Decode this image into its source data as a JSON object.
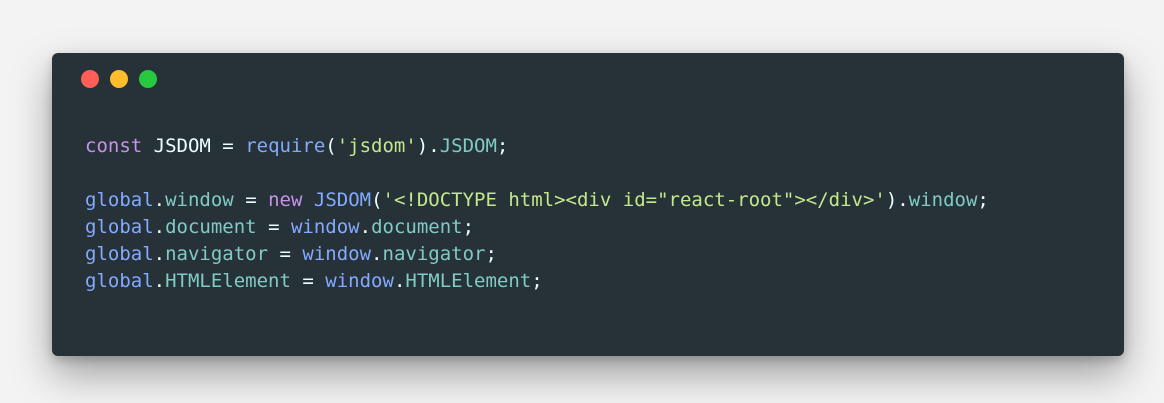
{
  "window": {
    "traffic_lights": [
      {
        "name": "close",
        "color": "#ff5f56"
      },
      {
        "name": "minimize",
        "color": "#ffbd2e"
      },
      {
        "name": "maximize",
        "color": "#27c93f"
      }
    ],
    "background": "#263238"
  },
  "code": {
    "lines": [
      [
        {
          "text": "const",
          "type": "keyword"
        },
        {
          "text": " JSDOM ",
          "type": "plain"
        },
        {
          "text": "=",
          "type": "op"
        },
        {
          "text": " ",
          "type": "plain"
        },
        {
          "text": "require",
          "type": "func"
        },
        {
          "text": "(",
          "type": "punct"
        },
        {
          "text": "'jsdom'",
          "type": "string"
        },
        {
          "text": ").",
          "type": "punct"
        },
        {
          "text": "JSDOM",
          "type": "prop"
        },
        {
          "text": ";",
          "type": "punct"
        }
      ],
      [],
      [
        {
          "text": "global",
          "type": "global"
        },
        {
          "text": ".",
          "type": "punct"
        },
        {
          "text": "window",
          "type": "prop"
        },
        {
          "text": " ",
          "type": "plain"
        },
        {
          "text": "=",
          "type": "op"
        },
        {
          "text": " ",
          "type": "plain"
        },
        {
          "text": "new",
          "type": "keyword"
        },
        {
          "text": " ",
          "type": "plain"
        },
        {
          "text": "JSDOM",
          "type": "func"
        },
        {
          "text": "(",
          "type": "punct"
        },
        {
          "text": "'<!DOCTYPE html><div id=\"react-root\"></div>'",
          "type": "string"
        },
        {
          "text": ").",
          "type": "punct"
        },
        {
          "text": "window",
          "type": "prop"
        },
        {
          "text": ";",
          "type": "punct"
        }
      ],
      [
        {
          "text": "global",
          "type": "global"
        },
        {
          "text": ".",
          "type": "punct"
        },
        {
          "text": "document",
          "type": "prop"
        },
        {
          "text": " ",
          "type": "plain"
        },
        {
          "text": "=",
          "type": "op"
        },
        {
          "text": " ",
          "type": "plain"
        },
        {
          "text": "window",
          "type": "global"
        },
        {
          "text": ".",
          "type": "punct"
        },
        {
          "text": "document",
          "type": "prop"
        },
        {
          "text": ";",
          "type": "punct"
        }
      ],
      [
        {
          "text": "global",
          "type": "global"
        },
        {
          "text": ".",
          "type": "punct"
        },
        {
          "text": "navigator",
          "type": "prop"
        },
        {
          "text": " ",
          "type": "plain"
        },
        {
          "text": "=",
          "type": "op"
        },
        {
          "text": " ",
          "type": "plain"
        },
        {
          "text": "window",
          "type": "global"
        },
        {
          "text": ".",
          "type": "punct"
        },
        {
          "text": "navigator",
          "type": "prop"
        },
        {
          "text": ";",
          "type": "punct"
        }
      ],
      [
        {
          "text": "global",
          "type": "global"
        },
        {
          "text": ".",
          "type": "punct"
        },
        {
          "text": "HTMLElement",
          "type": "prop"
        },
        {
          "text": " ",
          "type": "plain"
        },
        {
          "text": "=",
          "type": "op"
        },
        {
          "text": " ",
          "type": "plain"
        },
        {
          "text": "window",
          "type": "global"
        },
        {
          "text": ".",
          "type": "punct"
        },
        {
          "text": "HTMLElement",
          "type": "prop"
        },
        {
          "text": ";",
          "type": "punct"
        }
      ]
    ]
  }
}
